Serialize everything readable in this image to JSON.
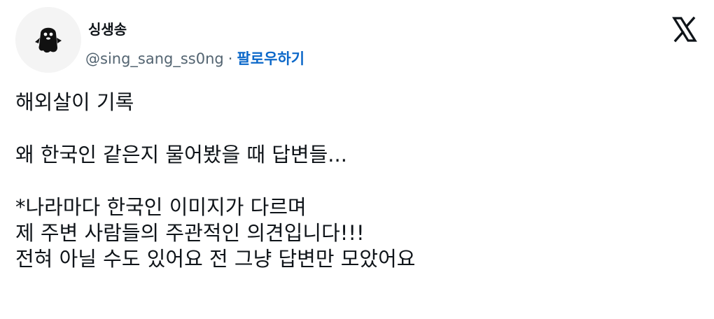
{
  "author": {
    "display_name": "싱생송",
    "handle": "@sing_sang_ss0ng",
    "separator": "·",
    "follow_label": "팔로우하기",
    "avatar_icon": "ghost-character-avatar-icon"
  },
  "platform": {
    "logo_icon": "x-logo-icon"
  },
  "tweet": {
    "line1": "해외살이 기록",
    "line2": "왜 한국인 같은지 물어봤을 때 답변들...",
    "line3": "*나라마다 한국인 이미지가 다르며",
    "line4": "제 주변 사람들의 주관적인 의견입니다!!!",
    "line5": "전혀 아닐 수도 있어요 전 그냥 답변만 모았어요"
  },
  "colors": {
    "text": "#0f1419",
    "secondary": "#536471",
    "link": "#0c68c9"
  }
}
